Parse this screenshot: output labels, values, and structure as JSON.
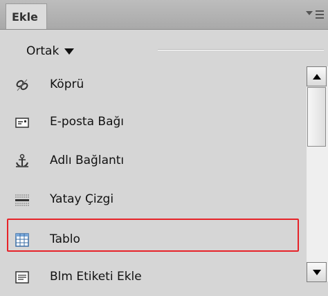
{
  "panel": {
    "tab_label": "Ekle",
    "menu_icon": "panel-options-icon"
  },
  "category": {
    "label": "Ortak"
  },
  "items": [
    {
      "label": "Köprü",
      "icon": "hyperlink-icon"
    },
    {
      "label": "E-posta Bağı",
      "icon": "email-link-icon"
    },
    {
      "label": "Adlı Bağlantı",
      "icon": "named-anchor-icon"
    },
    {
      "label": "Yatay Çizgi",
      "icon": "horizontal-rule-icon"
    },
    {
      "label": "Tablo",
      "icon": "table-icon",
      "selected": true
    },
    {
      "label": "Blm Etiketi Ekle",
      "icon": "insert-div-tag-icon"
    }
  ],
  "colors": {
    "highlight": "#e62228"
  }
}
